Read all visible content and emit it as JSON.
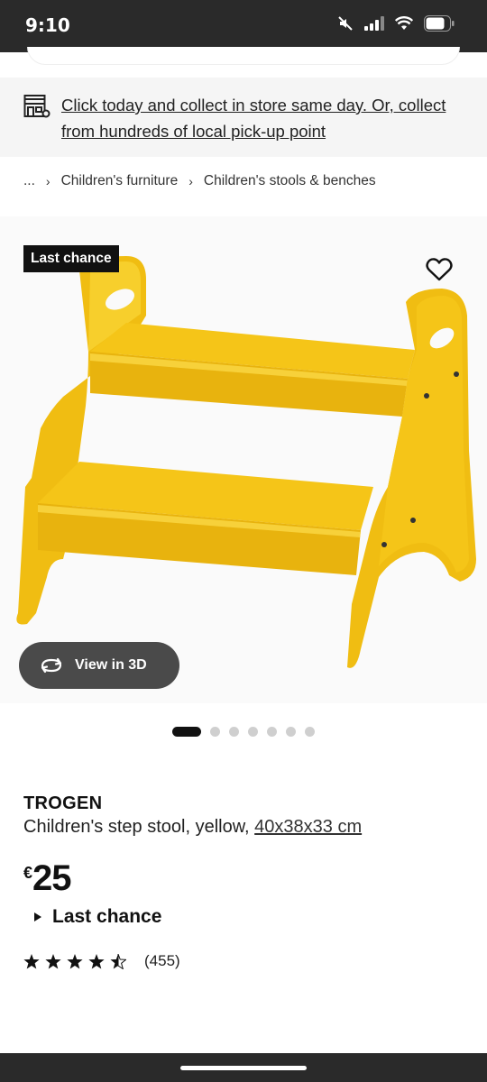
{
  "status": {
    "time": "9:10",
    "icons": [
      "mute-icon",
      "signal-icon",
      "wifi-icon",
      "battery-icon"
    ]
  },
  "banner": {
    "icon": "store-icon",
    "text": "Click today and collect in store same day. Or, collect from hundreds of local pick-up point"
  },
  "breadcrumb": {
    "items": [
      "...",
      "Children's furniture",
      "Children's stools & benches"
    ]
  },
  "gallery": {
    "badge": "Last chance",
    "view3d_label": "View in 3D",
    "slide_count": 7,
    "active_slide": 1,
    "product_color": "#f5c518"
  },
  "product": {
    "name": "TROGEN",
    "description": "Children's step stool, yellow,",
    "dimensions": "40x38x33 cm",
    "currency": "€",
    "price": "25",
    "availability": "Last chance",
    "rating": 4.5,
    "review_count": "(455)"
  }
}
